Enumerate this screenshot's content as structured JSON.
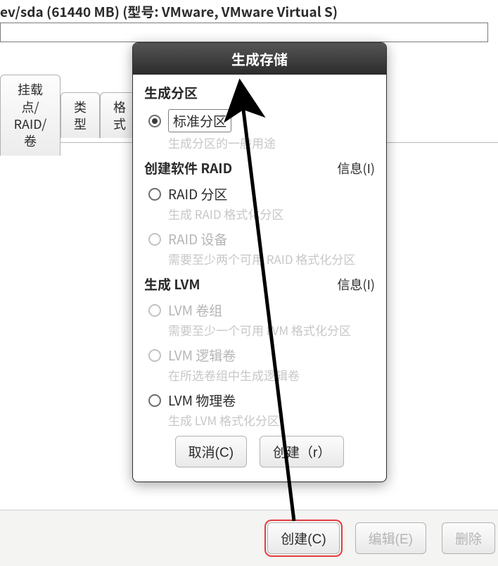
{
  "header": {
    "device_line": "ev/sda (61440 MB) (型号: VMware, VMware Virtual S)"
  },
  "columns": {
    "mount_raid": "挂载点/\nRAID/卷",
    "type": "类型",
    "format": "格式"
  },
  "dialog": {
    "title": "生成存储",
    "sections": {
      "partition": {
        "title": "生成分区",
        "standard": {
          "label": "标准分区",
          "desc": "生成分区的一般用途"
        }
      },
      "raid": {
        "title": "创建软件 RAID",
        "info": "信息(I)",
        "raid_part": {
          "label": "RAID 分区",
          "desc": "生成 RAID 格式化分区"
        },
        "raid_dev": {
          "label": "RAID 设备",
          "desc": "需要至少两个可用 RAID 格式化分区"
        }
      },
      "lvm": {
        "title": "生成 LVM",
        "info": "信息(I)",
        "vg": {
          "label": "LVM 卷组",
          "desc": "需要至少一个可用 LVM 格式化分区"
        },
        "lv": {
          "label": "LVM 逻辑卷",
          "desc": "在所选卷组中生成逻辑卷"
        },
        "pv": {
          "label": "LVM 物理卷",
          "desc": "生成 LVM 格式化分区"
        }
      }
    },
    "buttons": {
      "cancel": "取消(C)",
      "create": "创建（r）"
    }
  },
  "footer": {
    "create": "创建(C)",
    "edit": "编辑(E)",
    "delete": "删除"
  }
}
